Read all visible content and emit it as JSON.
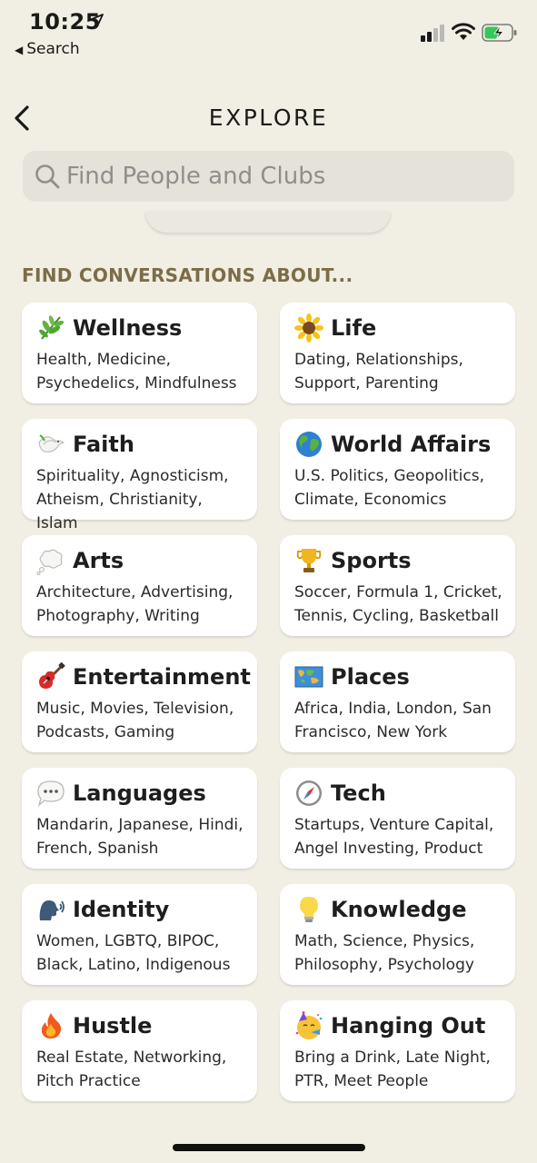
{
  "status_bar": {
    "time": "10:25",
    "back_app_label": "Search"
  },
  "header": {
    "title": "EXPLORE"
  },
  "search": {
    "placeholder": "Find People and Clubs"
  },
  "section": {
    "heading": "FIND CONVERSATIONS ABOUT..."
  },
  "topics": [
    {
      "title": "Wellness",
      "subtitle": "Health, Medicine, Psychedelics, Mindfulness",
      "icon": "herb-icon"
    },
    {
      "title": "Life",
      "subtitle": "Dating, Relationships, Support, Parenting",
      "icon": "sunflower-icon"
    },
    {
      "title": "Faith",
      "subtitle": "Spirituality, Agnosticism, Atheism, Christianity, Islam",
      "icon": "dove-icon"
    },
    {
      "title": "World Affairs",
      "subtitle": "U.S. Politics, Geopolitics, Climate, Economics",
      "icon": "globe-icon"
    },
    {
      "title": "Arts",
      "subtitle": "Architecture, Advertising, Photography, Writing",
      "icon": "thought-bubble-icon"
    },
    {
      "title": "Sports",
      "subtitle": "Soccer, Formula 1, Cricket, Tennis, Cycling, Basketball",
      "icon": "trophy-icon"
    },
    {
      "title": "Entertainment",
      "subtitle": "Music, Movies, Television, Podcasts, Gaming",
      "icon": "guitar-icon"
    },
    {
      "title": "Places",
      "subtitle": "Africa, India, London, San Francisco, New York",
      "icon": "world-map-icon"
    },
    {
      "title": "Languages",
      "subtitle": "Mandarin, Japanese, Hindi, French, Spanish",
      "icon": "speech-bubble-icon"
    },
    {
      "title": "Tech",
      "subtitle": "Startups, Venture Capital, Angel Investing, Product",
      "icon": "compass-icon"
    },
    {
      "title": "Identity",
      "subtitle": "Women, LGBTQ, BIPOC, Black, Latino, Indigenous",
      "icon": "speaking-head-icon"
    },
    {
      "title": "Knowledge",
      "subtitle": "Math, Science, Physics, Philosophy, Psychology",
      "icon": "light-bulb-icon"
    },
    {
      "title": "Hustle",
      "subtitle": "Real Estate, Networking, Pitch Practice",
      "icon": "fire-icon"
    },
    {
      "title": "Hanging Out",
      "subtitle": "Bring a Drink, Late Night, PTR, Meet People",
      "icon": "party-face-icon"
    }
  ],
  "colors": {
    "background": "#f1efe4",
    "card": "#ffffff",
    "search_field": "#e4e2d9",
    "section_heading": "#7c6c48",
    "battery_charging": "#34c759"
  }
}
